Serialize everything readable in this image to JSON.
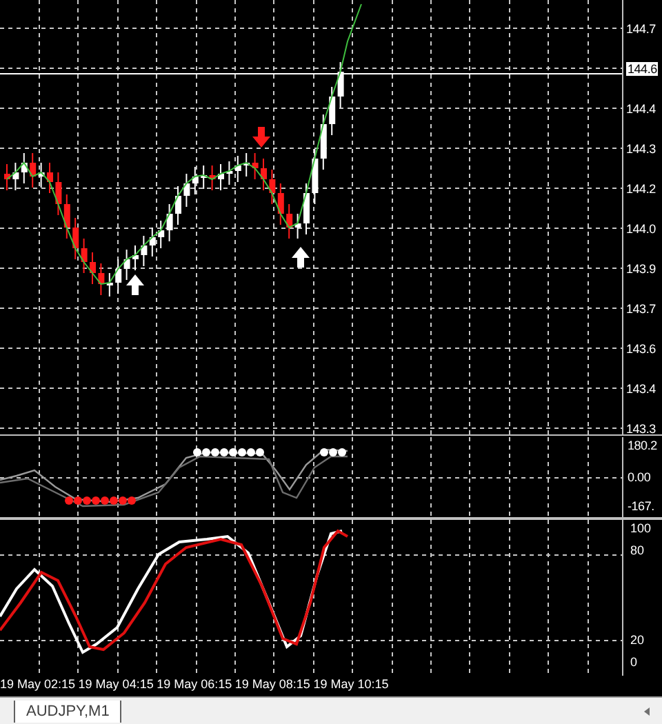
{
  "main_chart": {
    "price_labels": [
      {
        "text": "144.7",
        "current": false
      },
      {
        "text": "144.6",
        "current": true
      },
      {
        "text": "144.4",
        "current": false
      },
      {
        "text": "144.3",
        "current": false
      },
      {
        "text": "144.2",
        "current": false
      },
      {
        "text": "144.0",
        "current": false
      },
      {
        "text": "143.9",
        "current": false
      },
      {
        "text": "143.7",
        "current": false
      },
      {
        "text": "143.6",
        "current": false
      },
      {
        "text": "143.4",
        "current": false
      },
      {
        "text": "143.3",
        "current": false
      }
    ]
  },
  "indicator_1": {
    "labels": [
      "180.2",
      "0.00",
      "-167."
    ]
  },
  "indicator_2": {
    "labels": [
      "100",
      "80",
      "20",
      "0"
    ]
  },
  "time_axis": {
    "labels": [
      "19 May 02:15",
      "19 May 04:15",
      "19 May 06:15",
      "19 May 08:15",
      "19 May 10:15"
    ]
  },
  "tabs": [
    {
      "label": "AUDJPY,M1",
      "selected": true
    }
  ]
}
